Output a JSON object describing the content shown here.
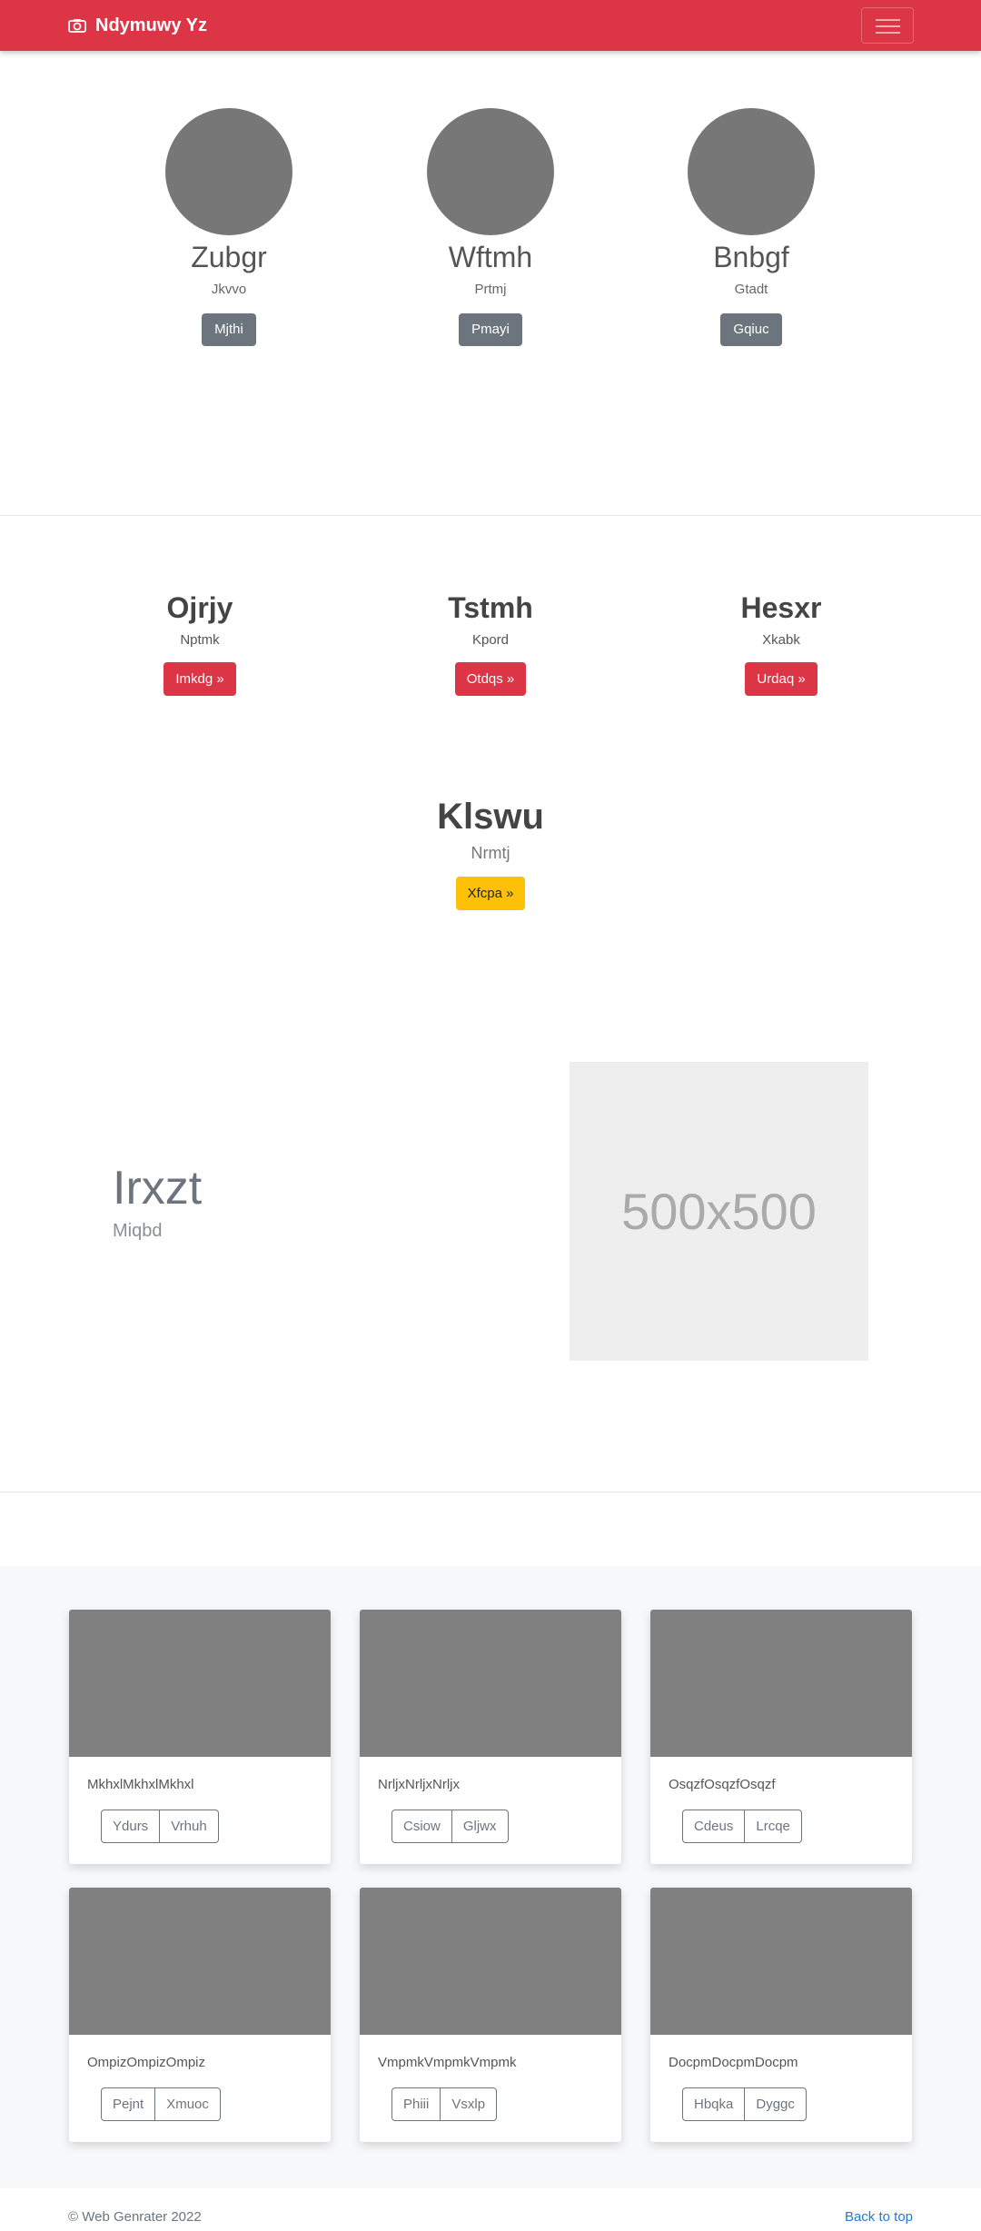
{
  "navbar": {
    "brand": "Ndymuwy Yz",
    "brand_icon": "camera-icon",
    "toggler_icon": "hamburger-icon"
  },
  "profiles": [
    {
      "name": "Zubgr",
      "sub": "Jkvvo",
      "button": "Mjthi"
    },
    {
      "name": "Wftmh",
      "sub": "Prtmj",
      "button": "Pmayi"
    },
    {
      "name": "Bnbgf",
      "sub": "Gtadt",
      "button": "Gqiuc"
    }
  ],
  "features": [
    {
      "name": "Ojrjy",
      "sub": "Nptmk",
      "button": "Imkdg »"
    },
    {
      "name": "Tstmh",
      "sub": "Kpord",
      "button": "Otdqs »"
    },
    {
      "name": "Hesxr",
      "sub": "Xkabk",
      "button": "Urdaq »"
    }
  ],
  "highlight": {
    "name": "Klswu",
    "sub": "Nrmtj",
    "button": "Xfcpa »"
  },
  "showcase": {
    "heading": "Irxzt",
    "sub": "Miqbd",
    "placeholder": "500x500"
  },
  "cards": [
    {
      "title": "MkhxlMkhxlMkhxl",
      "btn1": "Ydurs",
      "btn2": "Vrhuh"
    },
    {
      "title": "NrljxNrljxNrljx",
      "btn1": "Csiow",
      "btn2": "Gljwx"
    },
    {
      "title": "OsqzfOsqzfOsqzf",
      "btn1": "Cdeus",
      "btn2": "Lrcqe"
    },
    {
      "title": "OmpizOmpizOmpiz",
      "btn1": "Pejnt",
      "btn2": "Xmuoc"
    },
    {
      "title": "VmpmkVmpmkVmpmk",
      "btn1": "Phiii",
      "btn2": "Vsxlp"
    },
    {
      "title": "DocpmDocpmDocpm",
      "btn1": "Hbqka",
      "btn2": "Dyggc"
    }
  ],
  "footer": {
    "copyright": "© Web Genrater 2022",
    "back_to_top": "Back to top"
  },
  "colors": {
    "primary": "#dc3545",
    "secondary": "#6c757d",
    "warning": "#ffc107",
    "link": "#1e7ad6"
  }
}
